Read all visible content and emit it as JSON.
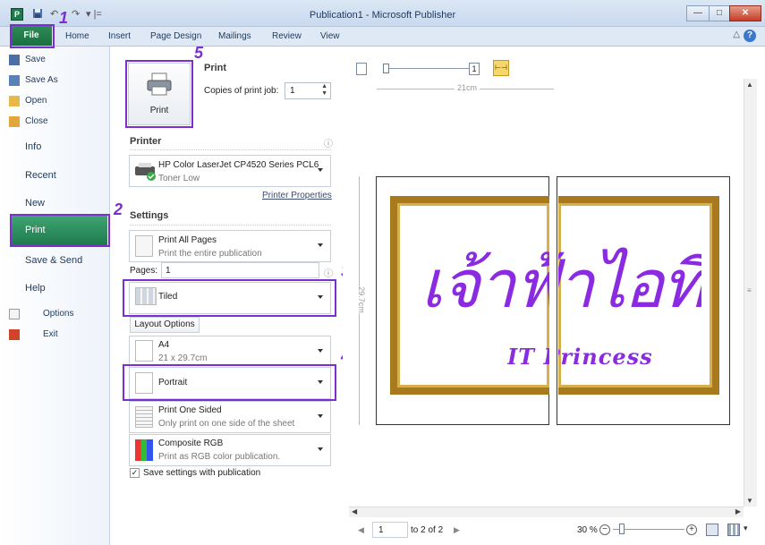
{
  "window": {
    "title": "Publication1 - Microsoft Publisher",
    "app_icon_letter": "P",
    "qat_undo": "↶",
    "qat_redo": "↷",
    "qat_customize": "▾ |=",
    "min_label": "—",
    "max_label": "□",
    "close_label": "✕"
  },
  "ribbon": {
    "file_label": "File",
    "tabs": [
      "Home",
      "Insert",
      "Page Design",
      "Mailings",
      "Review",
      "View"
    ],
    "help_label": "?"
  },
  "backstage": {
    "small_items": [
      "Save",
      "Save As",
      "Open",
      "Close"
    ],
    "large_items": [
      "Info",
      "Recent",
      "New",
      "Print",
      "Save & Send",
      "Help"
    ],
    "bottom_items": [
      "Options",
      "Exit"
    ]
  },
  "print": {
    "section_title": "Print",
    "button_label": "Print",
    "copies_label": "Copies of print job:",
    "copies_value": "1",
    "printer_header": "Printer",
    "info_glyph": "ⓘ",
    "printer_name": "HP Color LaserJet CP4520 Series PCL6",
    "printer_status": "Toner Low",
    "printer_properties": "Printer Properties",
    "settings_header": "Settings",
    "print_all_title": "Print All Pages",
    "print_all_sub": "Print the entire publication",
    "pages_label": "Pages:",
    "pages_value": "1",
    "tiled": "Tiled",
    "layout_options": "Layout Options",
    "paper_title": "A4",
    "paper_sub": "21 x 29.7cm",
    "orientation": "Portrait",
    "sided_title": "Print One Sided",
    "sided_sub": "Only print on one side of the sheet",
    "color_title": "Composite RGB",
    "color_sub": "Print as RGB color publication.",
    "save_settings": "Save settings with publication",
    "save_settings_checked": true
  },
  "annotations": [
    "1",
    "2",
    "3",
    "4",
    "5"
  ],
  "preview": {
    "ruler_h": "21cm",
    "ruler_v": "29.7cm",
    "view_one_label": "1",
    "thai_text": "เจ้าฟ้าไอที",
    "eng_text": "IT Princess",
    "page_value": "1",
    "page_of": "to 2 of 2",
    "zoom": "30 %"
  }
}
